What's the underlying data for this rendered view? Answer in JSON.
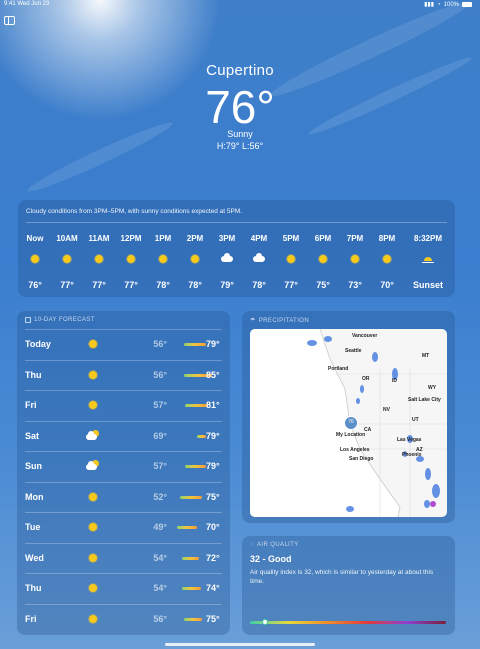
{
  "status_bar": {
    "time": "9:41  Wed Jun 23",
    "battery": "100%"
  },
  "header": {
    "city": "Cupertino",
    "temperature": "76°",
    "condition": "Sunny",
    "hi_lo": "H:79°  L:56°"
  },
  "hourly": {
    "summary": "Cloudy conditions from 3PM–5PM, with sunny conditions expected at 5PM.",
    "items": [
      {
        "time": "Now",
        "icon": "sun-icon",
        "value": "76°"
      },
      {
        "time": "10AM",
        "icon": "sun-icon",
        "value": "77°"
      },
      {
        "time": "11AM",
        "icon": "sun-icon",
        "value": "77°"
      },
      {
        "time": "12PM",
        "icon": "sun-icon",
        "value": "77°"
      },
      {
        "time": "1PM",
        "icon": "sun-icon",
        "value": "78°"
      },
      {
        "time": "2PM",
        "icon": "sun-icon",
        "value": "78°"
      },
      {
        "time": "3PM",
        "icon": "cloud-icon",
        "value": "79°"
      },
      {
        "time": "4PM",
        "icon": "cloud-icon",
        "value": "78°"
      },
      {
        "time": "5PM",
        "icon": "sun-icon",
        "value": "77°"
      },
      {
        "time": "6PM",
        "icon": "sun-icon",
        "value": "75°"
      },
      {
        "time": "7PM",
        "icon": "sun-icon",
        "value": "73°"
      },
      {
        "time": "8PM",
        "icon": "sun-icon",
        "value": "70°"
      },
      {
        "time": "8:32PM",
        "icon": "sunset-icon",
        "value": "Sunset"
      }
    ]
  },
  "ten_day": {
    "title": "10-DAY FORECAST",
    "temp_range": [
      45,
      90
    ],
    "days": [
      {
        "day": "Today",
        "icon": "sun-icon",
        "low": "56°",
        "high": "79°",
        "low_num": 56,
        "high_num": 79
      },
      {
        "day": "Thu",
        "icon": "sun-icon",
        "low": "56°",
        "high": "85°",
        "low_num": 56,
        "high_num": 85
      },
      {
        "day": "Fri",
        "icon": "sun-icon",
        "low": "57°",
        "high": "81°",
        "low_num": 57,
        "high_num": 81
      },
      {
        "day": "Sat",
        "icon": "partly-cloudy-icon",
        "low": "69°",
        "high": "79°",
        "low_num": 69,
        "high_num": 79
      },
      {
        "day": "Sun",
        "icon": "partly-cloudy-icon",
        "low": "57°",
        "high": "79°",
        "low_num": 57,
        "high_num": 79
      },
      {
        "day": "Mon",
        "icon": "sun-icon",
        "low": "52°",
        "high": "75°",
        "low_num": 52,
        "high_num": 75
      },
      {
        "day": "Tue",
        "icon": "sun-icon",
        "low": "49°",
        "high": "70°",
        "low_num": 49,
        "high_num": 70
      },
      {
        "day": "Wed",
        "icon": "sun-icon",
        "low": "54°",
        "high": "72°",
        "low_num": 54,
        "high_num": 72
      },
      {
        "day": "Thu",
        "icon": "sun-icon",
        "low": "54°",
        "high": "74°",
        "low_num": 54,
        "high_num": 74
      },
      {
        "day": "Fri",
        "icon": "sun-icon",
        "low": "56°",
        "high": "75°",
        "low_num": 56,
        "high_num": 75
      }
    ]
  },
  "precipitation": {
    "title": "PRECIPITATION",
    "my_location_temp": "76",
    "my_location_label": "My Location",
    "cities": {
      "vancouver": "Vancouver",
      "seattle": "Seattle",
      "portland": "Portland",
      "salt_lake_city": "Salt Lake City",
      "las_vegas": "Las Vegas",
      "los_angeles": "Los Angeles",
      "san_diego": "San Diego",
      "phoenix": "Phoenix"
    },
    "states": {
      "mt": "MT",
      "or": "OR",
      "id": "ID",
      "wy": "WY",
      "nv": "NV",
      "ut": "UT",
      "ca": "CA",
      "az": "AZ"
    }
  },
  "air_quality": {
    "title": "AIR QUALITY",
    "value": "32 - Good",
    "description": "Air quality index is 32, which is similar to yesterday at about this time.",
    "index_fraction": 0.06
  },
  "colors": {
    "sun": "#f7c81e",
    "card": "rgba(35,80,140,0.32)"
  }
}
